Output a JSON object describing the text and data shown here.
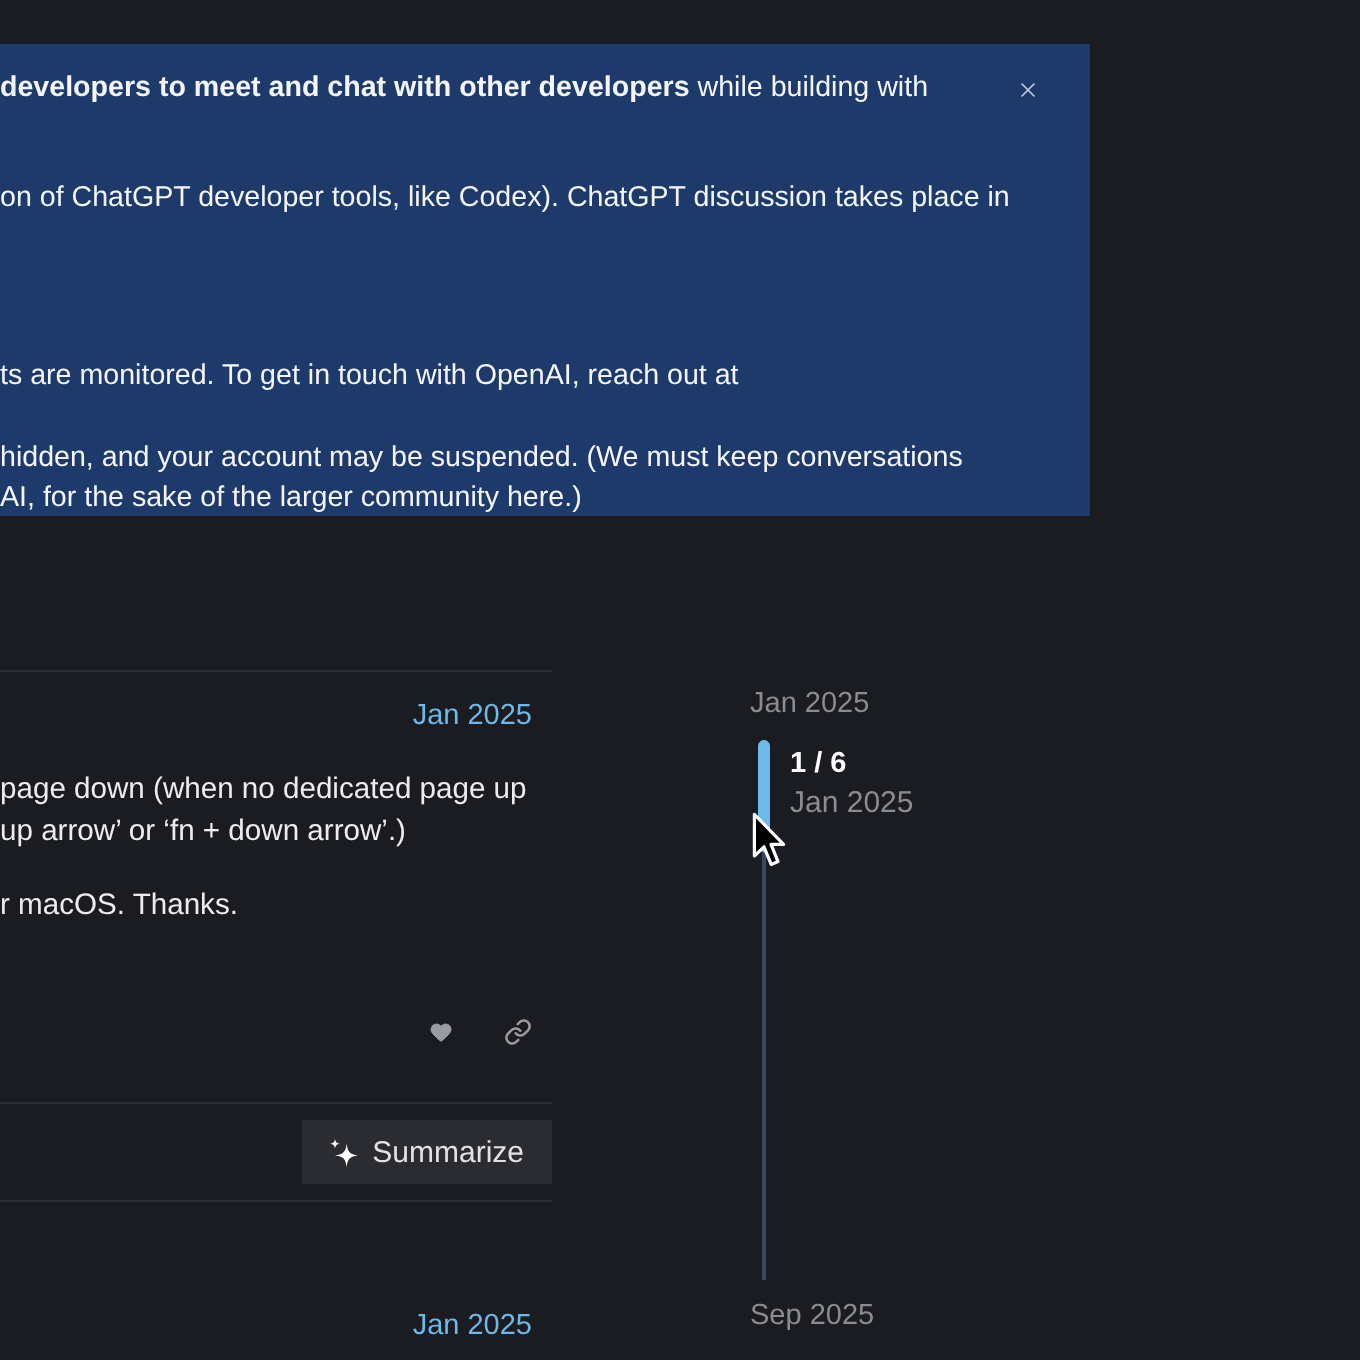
{
  "banner": {
    "paragraphs": [
      {
        "lines": [
          "**developers to meet and chat with other developers** while building with"
        ]
      },
      {
        "lines": [
          "on of ChatGPT developer tools, like Codex). ChatGPT discussion takes place in"
        ]
      },
      {
        "lines": [
          "ts are monitored. To get in touch with OpenAI, reach out at"
        ]
      },
      {
        "lines": [
          "hidden, and your account may be suspended. (We must keep conversations",
          "AI, for the sake of the larger community here.)"
        ]
      }
    ]
  },
  "post": {
    "date": "Jan 2025",
    "paragraphs": [
      {
        "lines": [
          "page down (when no dedicated page up",
          "up arrow’ or ‘fn + down arrow’.)"
        ]
      },
      {
        "lines": [
          "r macOS. Thanks."
        ]
      }
    ]
  },
  "summarize_button": {
    "label": "Summarize"
  },
  "next_post": {
    "date": "Jan 2025"
  },
  "timeline": {
    "start": "Jan 2025",
    "position": "1 / 6",
    "position_date": "Jan 2025",
    "end": "Sep 2025"
  }
}
